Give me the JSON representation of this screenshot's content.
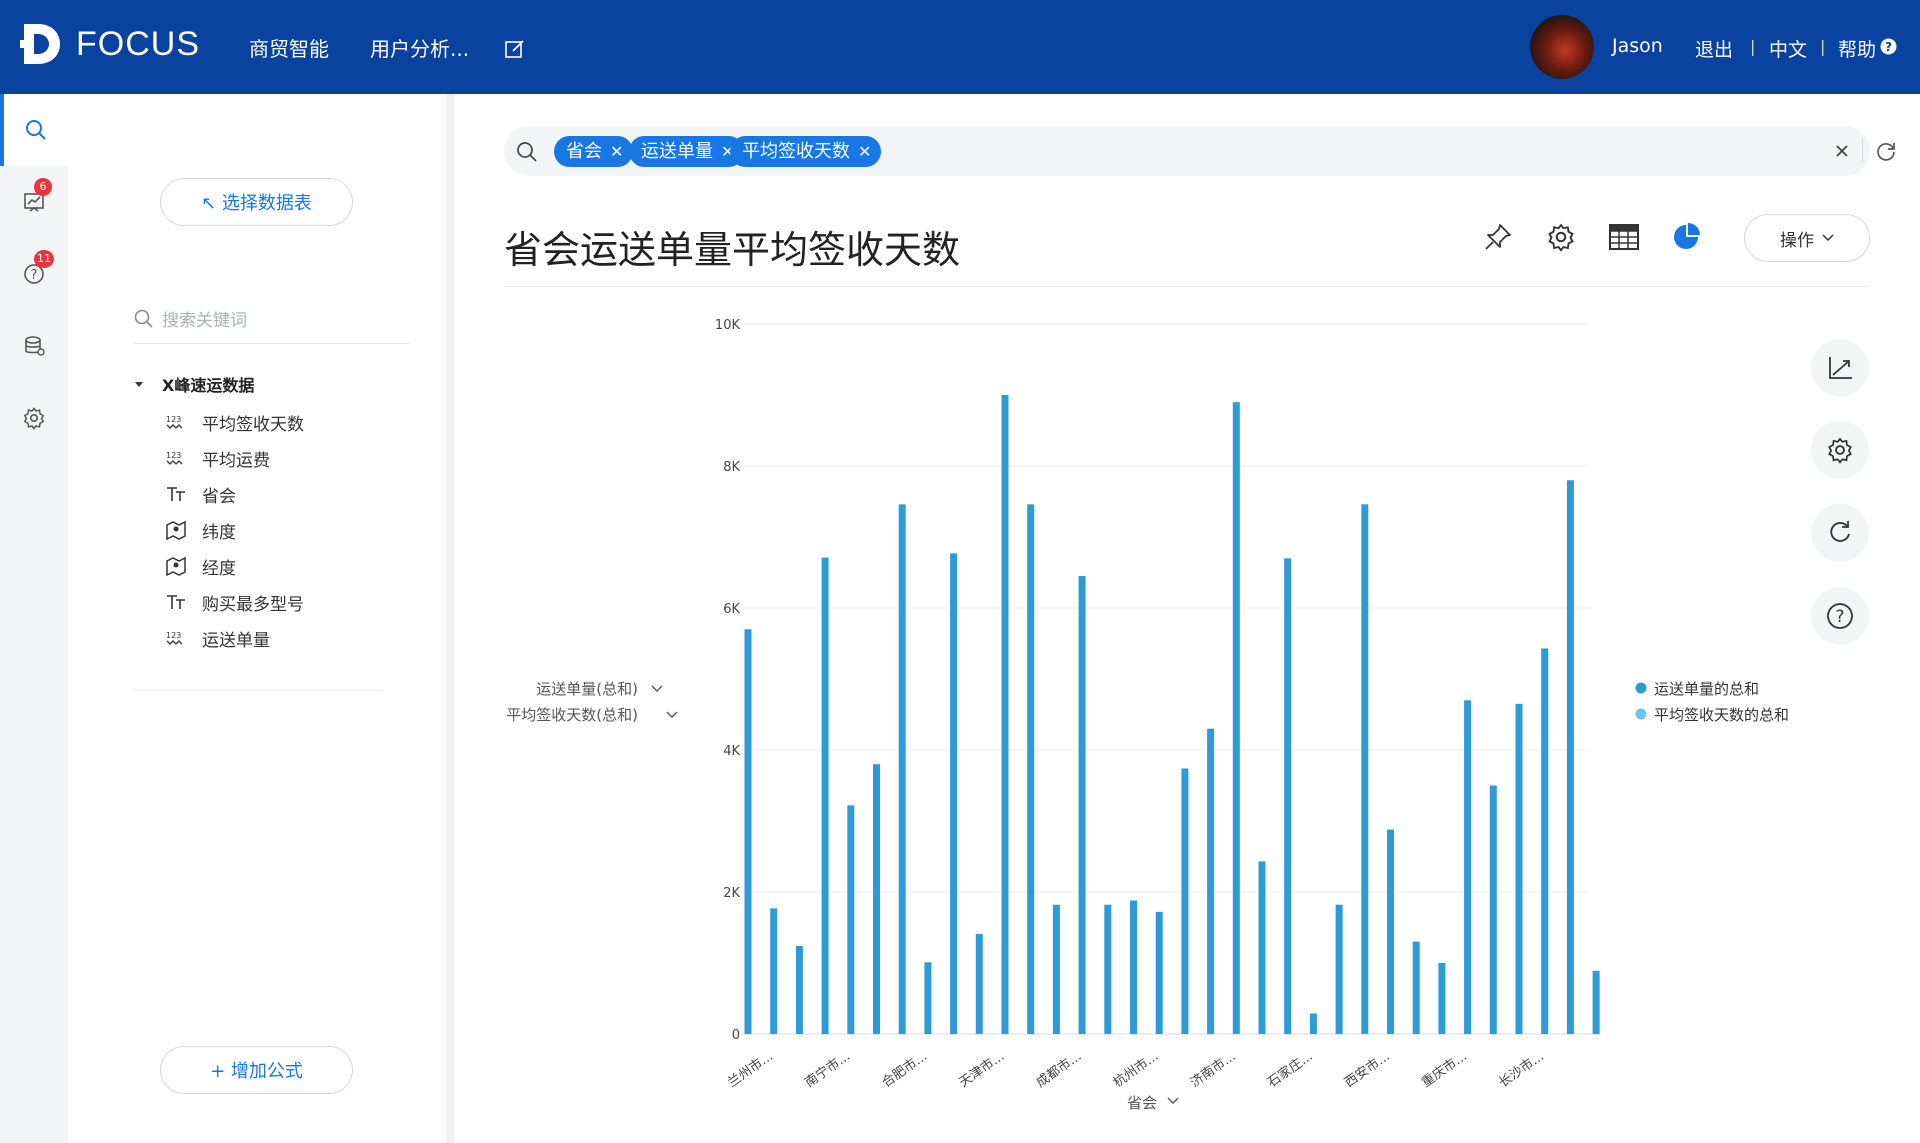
{
  "app": {
    "brand": "FOCUS",
    "nav": [
      "商贸智能",
      "用户分析..."
    ],
    "user_name": "Jason",
    "logout": "退出",
    "lang": "中文",
    "help": "帮助"
  },
  "rail": {
    "badges": {
      "kanban": "6",
      "questions": "11"
    }
  },
  "panel": {
    "select_table": "↖ 选择数据表",
    "search_placeholder": "搜索关键词",
    "table_name": "X峰速运数据",
    "fields": [
      {
        "name": "平均签收天数",
        "type": "number"
      },
      {
        "name": "平均运费",
        "type": "number"
      },
      {
        "name": "省会",
        "type": "text"
      },
      {
        "name": "纬度",
        "type": "geo"
      },
      {
        "name": "经度",
        "type": "geo"
      },
      {
        "name": "购买最多型号",
        "type": "text"
      },
      {
        "name": "运送单量",
        "type": "number"
      }
    ],
    "add_formula": "+ 增加公式"
  },
  "query": {
    "tags": [
      "省会",
      "运送单量",
      "平均签收天数"
    ]
  },
  "title": "省会运送单量平均签收天数",
  "operate": "操作",
  "colors": {
    "accent": "#1677e5",
    "bar": "#2f9ad8",
    "topbar": "#0a42a0"
  },
  "chart_data": {
    "type": "bar",
    "x_label": "省会",
    "y_selectors": [
      "运送单量(总和)",
      "平均签收天数(总和)"
    ],
    "yticks": [
      "0",
      "2K",
      "4K",
      "6K",
      "8K",
      "10K"
    ],
    "ylim": [
      0,
      10000
    ],
    "grid": true,
    "legend_position": "right",
    "legend": [
      "运送单量的总和",
      "平均签收天数的总和"
    ],
    "series": [
      {
        "name": "运送单量的总和",
        "values": [
          5700,
          1770,
          1240,
          6710,
          3220,
          3800,
          7460,
          1010,
          6770,
          1410,
          9000,
          7460,
          1820,
          6450,
          1820,
          1880,
          1720,
          3740,
          4300,
          8900,
          2430,
          6700,
          290,
          1820,
          7460,
          2880,
          1300,
          1000,
          4700,
          3500,
          4650,
          5430,
          7800,
          890
        ]
      }
    ],
    "xticks": [
      "兰州市...",
      "南宁市...",
      "合肥市...",
      "天津市...",
      "成都市...",
      "杭州市...",
      "济南市...",
      "石家庄...",
      "西安市...",
      "重庆市...",
      "长沙市..."
    ]
  }
}
